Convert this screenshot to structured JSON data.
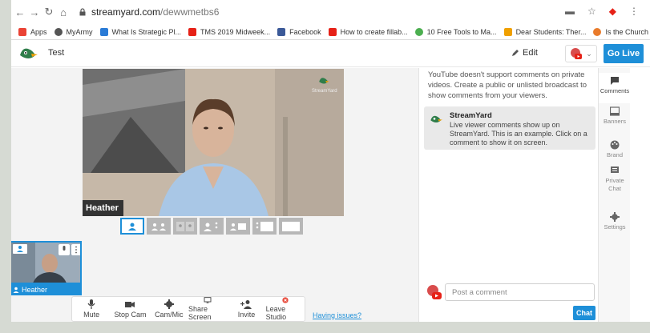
{
  "browser": {
    "url_host": "streamyard.com",
    "url_path": "/dewwmetbs6"
  },
  "bookmarks": [
    {
      "label": "Apps",
      "color": "#ea4335"
    },
    {
      "label": "MyArmy",
      "color": "#555555"
    },
    {
      "label": "What Is Strategic Pl...",
      "color": "#2a7bd6"
    },
    {
      "label": "TMS 2019 Midweek...",
      "color": "#e62117"
    },
    {
      "label": "Facebook",
      "color": "#3b5998"
    },
    {
      "label": "How to create fillab...",
      "color": "#e62117"
    },
    {
      "label": "10 Free Tools to Ma...",
      "color": "#4caf50"
    },
    {
      "label": "Dear Students: Ther...",
      "color": "#f0a000"
    },
    {
      "label": "Is the Church \"Esse...",
      "color": "#e97b2b"
    }
  ],
  "header": {
    "broadcast_name": "Test",
    "edit_label": "Edit",
    "go_live_label": "Go Live"
  },
  "stage": {
    "participant_name": "Heather",
    "watermark": "StreamYard"
  },
  "thumbnail": {
    "name": "Heather"
  },
  "controls": [
    {
      "label": "Mute",
      "icon": "mic-icon"
    },
    {
      "label": "Stop Cam",
      "icon": "camera-icon"
    },
    {
      "label": "Cam/Mic",
      "icon": "gear-icon"
    },
    {
      "label": "Share Screen",
      "icon": "monitor-icon"
    },
    {
      "label": "Invite",
      "icon": "add-person-icon"
    },
    {
      "label": "Leave Studio",
      "icon": "close-circle-icon"
    }
  ],
  "having_issues": "Having issues?",
  "comments": {
    "notice": "YouTube doesn't support comments on private videos. Create a public or unlisted broadcast to show comments from your viewers.",
    "card_title": "StreamYard",
    "card_text": "Live viewer comments show up on StreamYard. This is an example. Click on a comment to show it on screen.",
    "placeholder": "Post a comment",
    "chat_label": "Chat"
  },
  "rail": [
    {
      "label": "Comments",
      "icon": "comment-icon"
    },
    {
      "label": "Banners",
      "icon": "banner-icon"
    },
    {
      "label": "Brand",
      "icon": "palette-icon"
    },
    {
      "label": "Private Chat",
      "icon": "chat-icon"
    },
    {
      "label": "Settings",
      "icon": "gear-icon"
    }
  ],
  "colors": {
    "accent": "#1e8fd8",
    "youtube_red": "#e62117"
  }
}
